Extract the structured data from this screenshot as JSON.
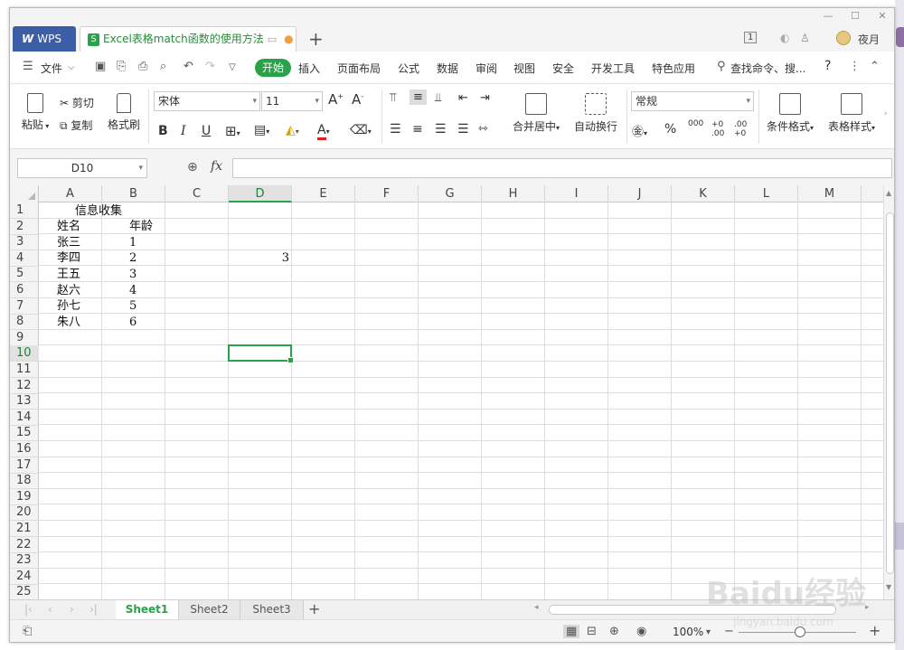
{
  "app": {
    "name": "WPS"
  },
  "tabs": [
    {
      "label": "Excel表格match函数的使用方法"
    }
  ],
  "user": {
    "name": "夜月",
    "badge": "1"
  },
  "menu": {
    "file": "文件",
    "items": [
      "开始",
      "插入",
      "页面布局",
      "公式",
      "数据",
      "审阅",
      "视图",
      "安全",
      "开发工具",
      "特色应用"
    ],
    "search": "查找命令、搜...",
    "help": "?"
  },
  "ribbon": {
    "paste": "粘贴",
    "cut": "剪切",
    "copy": "复制",
    "format_painter": "格式刷",
    "font_name": "宋体",
    "font_size": "11",
    "bold": "B",
    "italic": "I",
    "underline": "U",
    "merge_center": "合并居中",
    "wrap_text": "自动换行",
    "number_format": "常规",
    "percent": "%",
    "thousands": "000",
    "inc_decimal": "+0 .00",
    "dec_decimal": ".00 +0",
    "conditional_format": "条件格式",
    "table_style": "表格样式"
  },
  "formula_bar": {
    "name_box": "D10",
    "fx": "fx",
    "formula": ""
  },
  "sheet": {
    "columns": [
      "A",
      "B",
      "C",
      "D",
      "E",
      "F",
      "G",
      "H",
      "I",
      "J",
      "K",
      "L",
      "M"
    ],
    "rows": [
      "1",
      "2",
      "3",
      "4",
      "5",
      "6",
      "7",
      "8",
      "9",
      "10",
      "11",
      "12",
      "13",
      "14",
      "15",
      "16",
      "17",
      "18",
      "19",
      "20",
      "21",
      "22",
      "23",
      "24",
      "25"
    ],
    "selected_cell": "D10",
    "cells": {
      "A1": "信息收集",
      "A2": "姓名",
      "B2": "年龄",
      "A3": "张三",
      "B3": "1",
      "A4": "李四",
      "B4": "2",
      "D4": "3",
      "A5": "王五",
      "B5": "3",
      "A6": "赵六",
      "B6": "4",
      "A7": "孙七",
      "B7": "5",
      "A8": "朱八",
      "B8": "6"
    }
  },
  "sheet_tabs": [
    "Sheet1",
    "Sheet2",
    "Sheet3"
  ],
  "active_sheet": "Sheet1",
  "status": {
    "zoom": "100%"
  },
  "watermark": {
    "text": "Baidu经验",
    "sub": "jingyan.baidu.com"
  }
}
